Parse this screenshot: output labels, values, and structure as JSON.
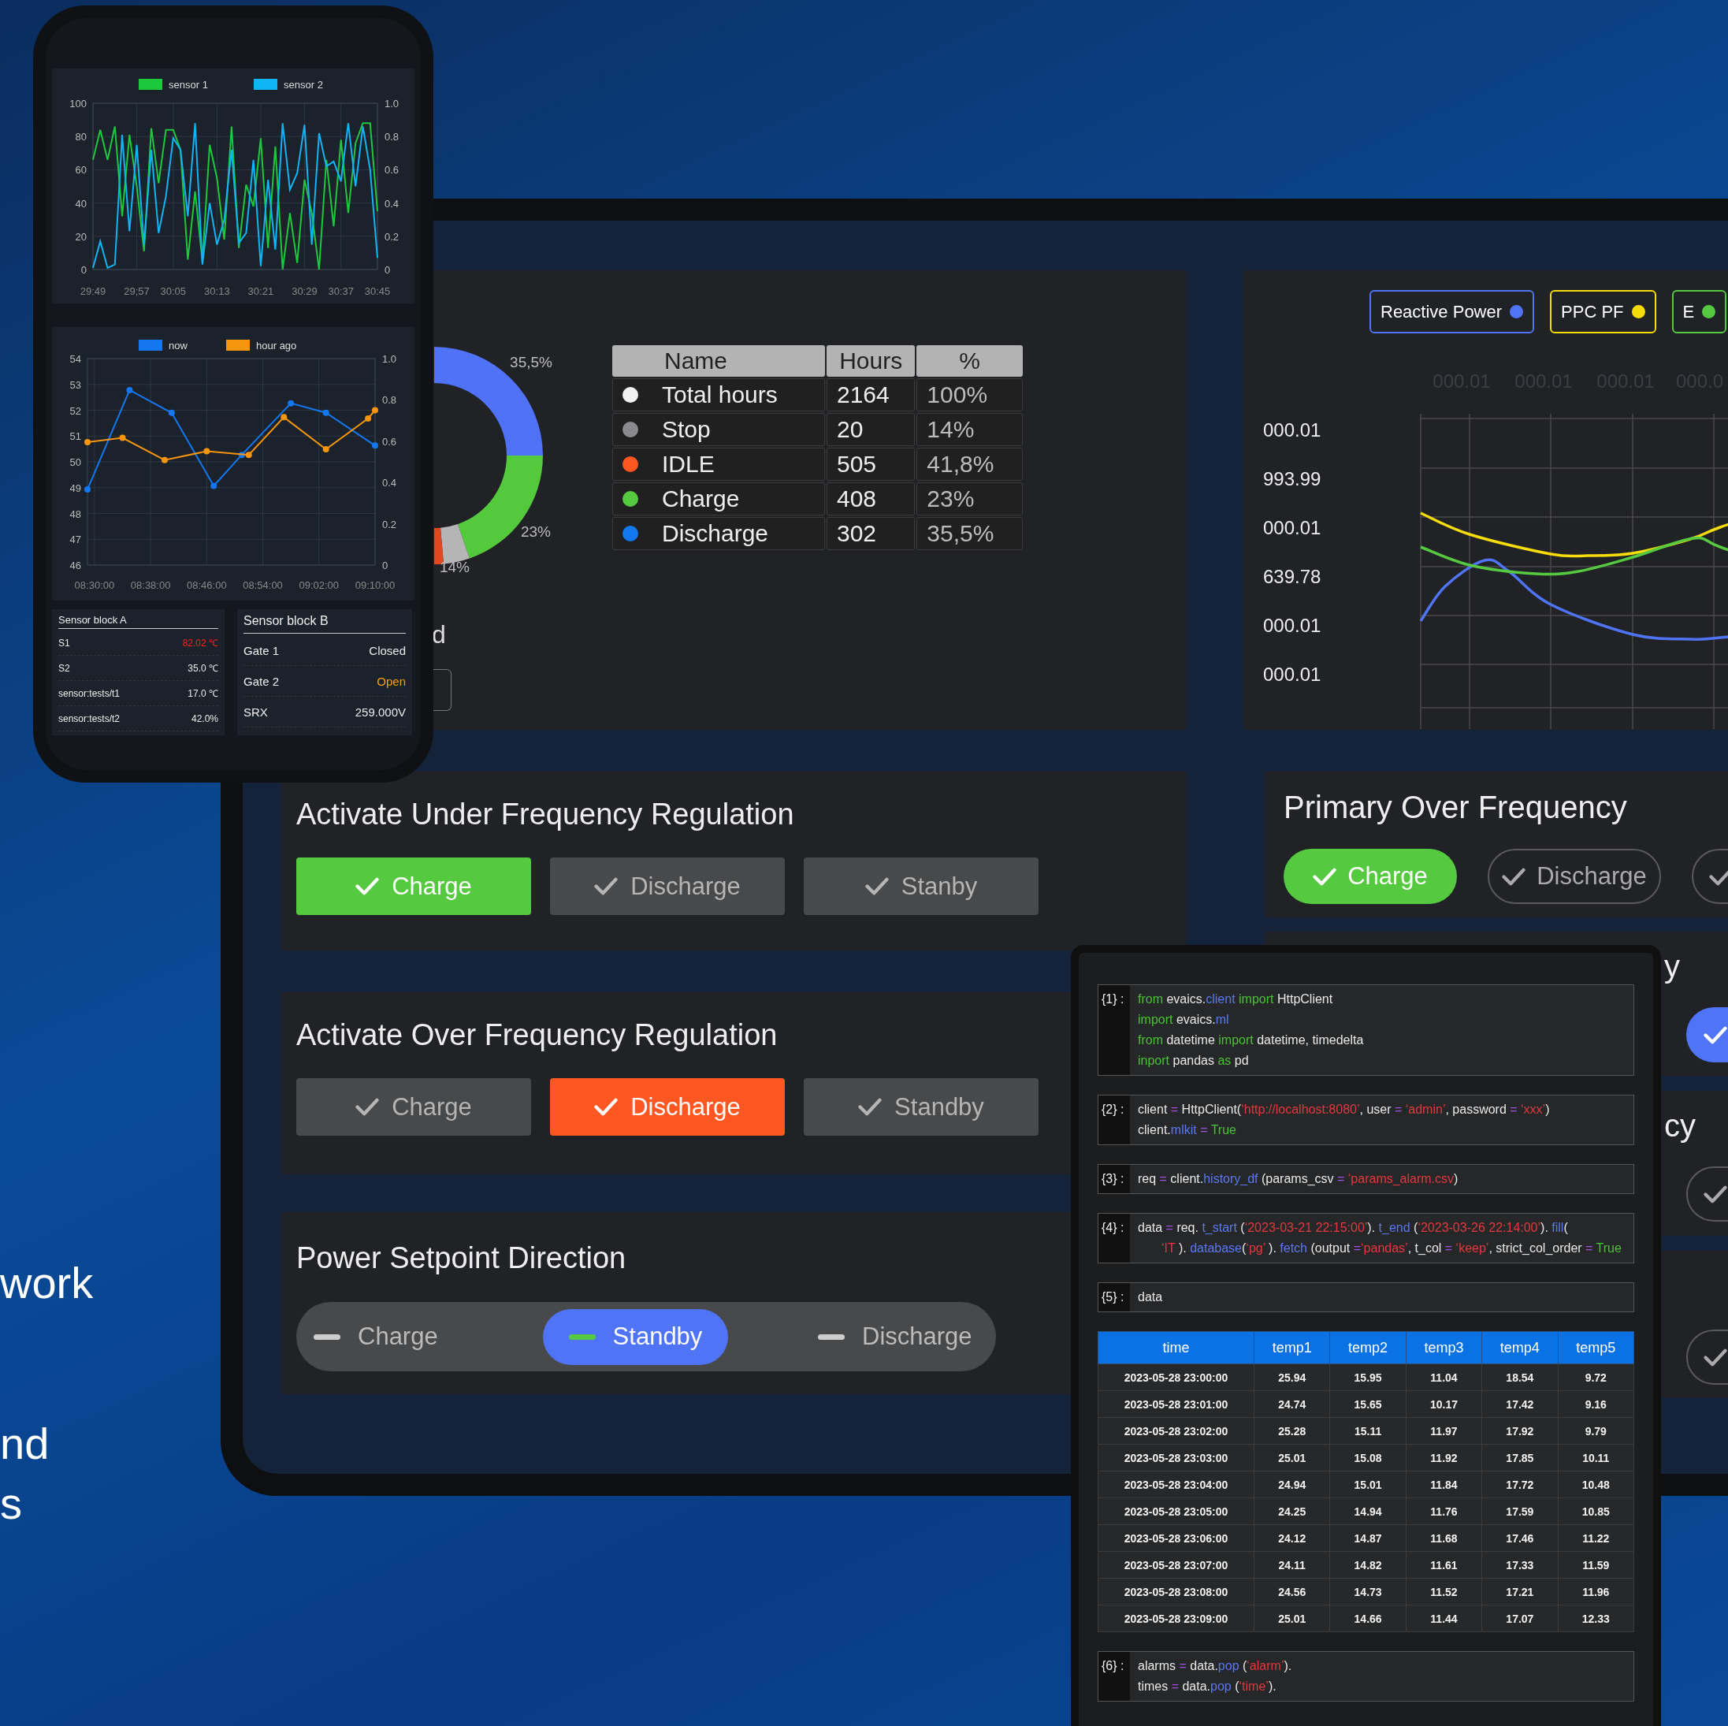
{
  "side_text": [
    "work",
    "nd",
    "s"
  ],
  "phone": {
    "charts": [
      {
        "chart_data": {
          "type": "line",
          "grid": true,
          "legend": true,
          "categories": [
            "29:49",
            null,
            null,
            null,
            null,
            null,
            "29;57",
            null,
            null,
            null,
            null,
            "30:05",
            null,
            null,
            null,
            null,
            null,
            "30:13",
            null,
            null,
            null,
            null,
            null,
            "30:21",
            null,
            null,
            null,
            null,
            null,
            "30:29",
            null,
            null,
            null,
            null,
            "30:37",
            null,
            null,
            null,
            null,
            "30:45"
          ],
          "series": [
            {
              "name": "sensor 1",
              "color": "#1ec83c",
              "values": [
                66,
                84,
                66,
                86,
                32,
                81,
                50,
                11,
                85,
                52,
                84,
                84,
                72,
                6,
                47,
                5,
                75,
                55,
                18,
                86,
                13,
                51,
                38,
                79,
                13,
                74,
                0,
                34,
                4,
                54,
                34,
                0,
                66,
                26,
                78,
                34,
                76,
                88,
                88,
                35
              ]
            },
            {
              "name": "sensor 2",
              "color": "#11b4f5",
              "values": [
                1,
                17,
                1,
                3,
                81,
                23,
                75,
                15,
                72,
                22,
                44,
                79,
                72,
                32,
                88,
                3,
                40,
                15,
                30,
                72,
                16,
                22,
                66,
                2,
                54,
                12,
                88,
                48,
                58,
                87,
                15,
                82,
                62,
                65,
                53,
                88,
                50,
                86,
                60,
                7
              ]
            }
          ],
          "ylim": [
            0,
            100
          ],
          "yticks": [
            0,
            20,
            40,
            60,
            80,
            100
          ],
          "y2ticks": [
            0,
            0.2,
            0.4,
            0.6,
            0.8,
            {
              "value": 1,
              "label": "1.0"
            }
          ],
          "y2lim": [
            0,
            1
          ]
        }
      },
      {
        "chart_data": {
          "type": "line",
          "grid": true,
          "legend": true,
          "categories": [
            null,
            "08:30:00",
            null,
            null,
            null,
            null,
            null,
            null,
            null,
            "08:38:00",
            null,
            null,
            null,
            null,
            null,
            null,
            null,
            "08:46:00",
            null,
            null,
            null,
            null,
            null,
            null,
            null,
            "08:54:00",
            null,
            null,
            null,
            null,
            null,
            null,
            null,
            "09:02:00",
            null,
            null,
            null,
            null,
            null,
            null,
            null,
            "09:10:00"
          ],
          "series": [
            {
              "name": "now",
              "color": "#1477f0",
              "marker": true,
              "values": [
                48.93,
                null,
                null,
                null,
                null,
                null,
                52.78,
                null,
                null,
                null,
                null,
                null,
                51.9,
                null,
                null,
                null,
                null,
                null,
                49.07,
                null,
                null,
                null,
                50.27,
                null,
                null,
                null,
                null,
                null,
                null,
                52.27,
                null,
                null,
                null,
                null,
                51.9,
                null,
                null,
                null,
                null,
                null,
                null,
                50.63
              ]
            },
            {
              "name": "hour ago",
              "color": "#f6950e",
              "marker": true,
              "values": [
                50.76,
                null,
                null,
                null,
                null,
                50.93,
                null,
                null,
                null,
                null,
                null,
                50.07,
                null,
                null,
                null,
                null,
                null,
                50.41,
                null,
                null,
                null,
                null,
                null,
                50.27,
                null,
                null,
                null,
                null,
                51.73,
                null,
                null,
                null,
                null,
                null,
                50.49,
                null,
                null,
                null,
                null,
                null,
                51.68,
                52.0
              ]
            }
          ],
          "ylim": [
            46,
            54
          ],
          "yticks": [
            46,
            47,
            48,
            49,
            50,
            51,
            52,
            53,
            54
          ],
          "y2ticks": [
            0,
            0.2,
            0.4,
            0.6,
            0.8,
            {
              "value": 1,
              "label": "1.0"
            }
          ],
          "y2lim": [
            0,
            1
          ]
        }
      }
    ],
    "sensor_blocks": [
      {
        "title": "Sensor block A",
        "rows": [
          {
            "name": "S1",
            "value": "82.02 ℃",
            "color": "#ff2020"
          },
          {
            "name": "S2",
            "value": "35.0 ℃",
            "color": "#e8e8e8"
          },
          {
            "name": "sensor:tests/t1",
            "value": "17.0 ℃",
            "color": "#e8e8e8"
          },
          {
            "name": "sensor:tests/t2",
            "value": "42.0%",
            "color": "#e8e8e8"
          }
        ]
      },
      {
        "title": "Sensor block B",
        "rows": [
          {
            "name": "Gate 1",
            "value": "Closed",
            "color": "#e8e8e8"
          },
          {
            "name": "Gate 2",
            "value": "Open",
            "color": "#f5a10e"
          },
          {
            "name": "SRX",
            "value": "259.000V",
            "color": "#e8e8e8"
          }
        ]
      }
    ]
  },
  "tablet": {
    "flow_panel": {
      "donut_labels": [
        "35,5%",
        "23%",
        "14%"
      ],
      "period_label": "d",
      "table": {
        "columns": [
          "Name",
          "Hours",
          "%"
        ],
        "rows": [
          {
            "color": "#f2f2f2",
            "name": "Total hours",
            "hours": "2164",
            "percent": "100%"
          },
          {
            "color": "#8a8a8e",
            "name": "Stop",
            "hours": "20",
            "percent": "14%"
          },
          {
            "color": "#ff5722",
            "name": "IDLE",
            "hours": "505",
            "percent": "41,8%"
          },
          {
            "color": "#55c940",
            "name": "Charge",
            "hours": "408",
            "percent": "23%"
          },
          {
            "color": "#1478f0",
            "name": "Discharge",
            "hours": "302",
            "percent": "35,5%"
          }
        ]
      }
    },
    "trend_panel": {
      "legend": [
        {
          "label": "Reactive Power",
          "color": "#4f74f5"
        },
        {
          "label": "PPC PF",
          "color": "#f5dc0a"
        },
        {
          "label": "E",
          "color": "#55c940"
        }
      ],
      "x_labels": [
        "000.01",
        "000.01",
        "000.01",
        "000.0"
      ],
      "y_labels": [
        "000.01",
        "993.99",
        "000.01",
        "639.78",
        "000.01",
        "000.01"
      ]
    },
    "regulation_panels": [
      {
        "title": "Activate Under Frequency Regulation",
        "kind": "buttons",
        "color": "#55c940",
        "options": [
          {
            "label": "Charge",
            "selected": true
          },
          {
            "label": "Discharge",
            "selected": false
          },
          {
            "label": "Stanby",
            "selected": false
          }
        ]
      },
      {
        "title": "Activate Over Frequency Regulation",
        "kind": "buttons",
        "color": "#ff5722",
        "options": [
          {
            "label": "Charge",
            "selected": false
          },
          {
            "label": "Discharge",
            "selected": true
          },
          {
            "label": "Standby",
            "selected": false
          }
        ]
      },
      {
        "title": "Power Setpoint Direction",
        "kind": "segmented",
        "color": "#4f74f5",
        "options": [
          {
            "label": "Charge",
            "selected": false
          },
          {
            "label": "Standby",
            "selected": true
          },
          {
            "label": "Discharge",
            "selected": false
          }
        ]
      }
    ],
    "side_panels": [
      {
        "kind": "pills",
        "title": "Primary Over Frequency",
        "color": "#55c940",
        "options": [
          {
            "label": "Charge",
            "selected": true
          },
          {
            "label": "Discharge",
            "selected": false
          },
          {
            "selected": false
          }
        ]
      },
      {
        "kind": "partial",
        "title": "y",
        "color": "#4f74f5",
        "options": [
          {
            "selected": true
          }
        ]
      },
      {
        "kind": "partial",
        "title": "cy",
        "options": [
          {
            "selected": false
          }
        ]
      },
      {
        "kind": "partial",
        "options": [
          {
            "selected": false
          }
        ]
      }
    ]
  },
  "notebook": {
    "cells": [
      {
        "kind": "code",
        "prompt": "{1} :",
        "lines": [
          {
            "indent": false,
            "tokens": [
              {
                "text": "from",
                "color": "#4cc038"
              },
              {
                "text": " evaics.",
                "color": "#e8e8e8"
              },
              {
                "text": "client",
                "color": "#5a78f0"
              },
              {
                "text": " import",
                "color": "#4cc038"
              },
              {
                "text": " HttpClient",
                "color": "#e8e8e8"
              }
            ]
          },
          {
            "indent": false,
            "tokens": [
              {
                "text": "import",
                "color": "#4cc038"
              },
              {
                "text": " evaics.",
                "color": "#e8e8e8"
              },
              {
                "text": "ml",
                "color": "#5a78f0"
              }
            ]
          },
          {
            "indent": false,
            "tokens": [
              {
                "text": "from",
                "color": "#4cc038"
              },
              {
                "text": " datetime ",
                "color": "#e8e8e8"
              },
              {
                "text": "import",
                "color": "#4cc038"
              },
              {
                "text": " datetime, timedelta",
                "color": "#e8e8e8"
              }
            ]
          },
          {
            "indent": false,
            "tokens": [
              {
                "text": "inport",
                "color": "#4cc038"
              },
              {
                "text": " pandas ",
                "color": "#e8e8e8"
              },
              {
                "text": "as",
                "color": "#4cc038"
              },
              {
                "text": " pd",
                "color": "#e8e8e8"
              }
            ]
          }
        ]
      },
      {
        "kind": "code",
        "prompt": "{2} :",
        "lines": [
          {
            "indent": false,
            "tokens": [
              {
                "text": "client ",
                "color": "#e8e8e8"
              },
              {
                "text": "=",
                "color": "#a050e0"
              },
              {
                "text": " HttpClient(",
                "color": "#e8e8e8"
              },
              {
                "text": "‘http://localhost:8080’",
                "color": "#e0393e"
              },
              {
                "text": ", user ",
                "color": "#e8e8e8"
              },
              {
                "text": "=",
                "color": "#a050e0"
              },
              {
                "text": " ‘admin’",
                "color": "#e0393e"
              },
              {
                "text": ", password ",
                "color": "#e8e8e8"
              },
              {
                "text": "=",
                "color": "#a050e0"
              },
              {
                "text": " ‘xxx’",
                "color": "#e0393e"
              },
              {
                "text": ")",
                "color": "#e8e8e8"
              }
            ]
          },
          {
            "indent": false,
            "tokens": [
              {
                "text": "client.",
                "color": "#e8e8e8"
              },
              {
                "text": "mlkit",
                "color": "#5a78f0"
              },
              {
                "text": " = ",
                "color": "#a050e0"
              },
              {
                "text": "True",
                "color": "#4cc038"
              }
            ]
          }
        ]
      },
      {
        "kind": "code",
        "prompt": "{3} :",
        "lines": [
          {
            "indent": false,
            "tokens": [
              {
                "text": "req ",
                "color": "#e8e8e8"
              },
              {
                "text": "=",
                "color": "#a050e0"
              },
              {
                "text": " client.",
                "color": "#e8e8e8"
              },
              {
                "text": "history_df",
                "color": "#5a78f0"
              },
              {
                "text": " (params_csv ",
                "color": "#e8e8e8"
              },
              {
                "text": "=",
                "color": "#a050e0"
              },
              {
                "text": " ‘params_alarm.csv",
                "color": "#e0393e"
              },
              {
                "text": ")",
                "color": "#e8e8e8"
              }
            ]
          }
        ]
      },
      {
        "kind": "code",
        "prompt": "{4} :",
        "lines": [
          {
            "indent": false,
            "tokens": [
              {
                "text": "data ",
                "color": "#e8e8e8"
              },
              {
                "text": "=",
                "color": "#a050e0"
              },
              {
                "text": " req. ",
                "color": "#e8e8e8"
              },
              {
                "text": "t_start",
                "color": "#5a78f0"
              },
              {
                "text": " (",
                "color": "#e8e8e8"
              },
              {
                "text": "‘2023-03-21 22:15:00’",
                "color": "#e0393e"
              },
              {
                "text": "). ",
                "color": "#e8e8e8"
              },
              {
                "text": "t_end",
                "color": "#5a78f0"
              },
              {
                "text": " (",
                "color": "#e8e8e8"
              },
              {
                "text": "‘2023-03-26 22:14:00’",
                "color": "#e0393e"
              },
              {
                "text": "). ",
                "color": "#e8e8e8"
              },
              {
                "text": "fill",
                "color": "#5a78f0"
              },
              {
                "text": "(",
                "color": "#e8e8e8"
              }
            ]
          },
          {
            "indent": true,
            "tokens": [
              {
                "text": "‘IT",
                "color": "#e0393e"
              },
              {
                "text": " ). ",
                "color": "#e8e8e8"
              },
              {
                "text": "database",
                "color": "#5a78f0"
              },
              {
                "text": "(",
                "color": "#e8e8e8"
              },
              {
                "text": "‘pg’",
                "color": "#e0393e"
              },
              {
                "text": " ). ",
                "color": "#e8e8e8"
              },
              {
                "text": "fetch",
                "color": "#5a78f0"
              },
              {
                "text": " (output ",
                "color": "#e8e8e8"
              },
              {
                "text": "=",
                "color": "#a050e0"
              },
              {
                "text": "‘pandas’",
                "color": "#e0393e"
              },
              {
                "text": ", t_col ",
                "color": "#e8e8e8"
              },
              {
                "text": "=",
                "color": "#a050e0"
              },
              {
                "text": " ‘keep’",
                "color": "#e0393e"
              },
              {
                "text": ", strict_col_order ",
                "color": "#e8e8e8"
              },
              {
                "text": "=",
                "color": "#a050e0"
              },
              {
                "text": " True",
                "color": "#4cc038"
              }
            ]
          }
        ]
      },
      {
        "kind": "code",
        "prompt": "{5} :",
        "lines": [
          {
            "indent": false,
            "tokens": [
              {
                "text": "data",
                "color": "#e8e8e8"
              }
            ]
          }
        ]
      },
      {
        "kind": "table",
        "columns": [
          "time",
          "temp1",
          "temp2",
          "temp3",
          "temp4",
          "temp5"
        ],
        "rows": [
          [
            "2023-05-28 23:00:00",
            "25.94",
            "15.95",
            "11.04",
            "18.54",
            "9.72"
          ],
          [
            "2023-05-28 23:01:00",
            "24.74",
            "15.65",
            "10.17",
            "17.42",
            "9.16"
          ],
          [
            "2023-05-28 23:02:00",
            "25.28",
            "15.11",
            "11.97",
            "17.92",
            "9.79"
          ],
          [
            "2023-05-28 23:03:00",
            "25.01",
            "15.08",
            "11.92",
            "17.85",
            "10.11"
          ],
          [
            "2023-05-28 23:04:00",
            "24.94",
            "15.01",
            "11.84",
            "17.72",
            "10.48"
          ],
          [
            "2023-05-28 23:05:00",
            "24.25",
            "14.94",
            "11.76",
            "17.59",
            "10.85"
          ],
          [
            "2023-05-28 23:06:00",
            "24.12",
            "14.87",
            "11.68",
            "17.46",
            "11.22"
          ],
          [
            "2023-05-28 23:07:00",
            "24.11",
            "14.82",
            "11.61",
            "17.33",
            "11.59"
          ],
          [
            "2023-05-28 23:08:00",
            "24.56",
            "14.73",
            "11.52",
            "17.21",
            "11.96"
          ],
          [
            "2023-05-28 23:09:00",
            "25.01",
            "14.66",
            "11.44",
            "17.07",
            "12.33"
          ]
        ]
      },
      {
        "kind": "code",
        "prompt": "{6} :",
        "lines": [
          {
            "indent": false,
            "tokens": [
              {
                "text": "alarms ",
                "color": "#e8e8e8"
              },
              {
                "text": "=",
                "color": "#a050e0"
              },
              {
                "text": " data.",
                "color": "#e8e8e8"
              },
              {
                "text": "pop",
                "color": "#5a78f0"
              },
              {
                "text": " (",
                "color": "#e8e8e8"
              },
              {
                "text": "‘alarm’",
                "color": "#e0393e"
              },
              {
                "text": ").",
                "color": "#e8e8e8"
              }
            ]
          },
          {
            "indent": false,
            "tokens": [
              {
                "text": "times ",
                "color": "#e8e8e8"
              },
              {
                "text": "=",
                "color": "#a050e0"
              },
              {
                "text": " data.",
                "color": "#e8e8e8"
              },
              {
                "text": "pop",
                "color": "#5a78f0"
              },
              {
                "text": " (",
                "color": "#e8e8e8"
              },
              {
                "text": "‘time’",
                "color": "#e0393e"
              },
              {
                "text": ").",
                "color": "#e8e8e8"
              }
            ]
          }
        ]
      }
    ]
  }
}
